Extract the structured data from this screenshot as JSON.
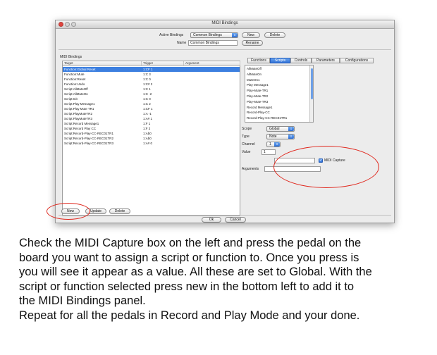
{
  "window": {
    "title": "MIDI Bindings"
  },
  "header": {
    "active_bindings_label": "Active Bindings",
    "active_bindings_value": "Common Bindings",
    "new_label": "New",
    "delete_label": "Delete",
    "name_label": "Name",
    "name_value": "Common Bindings",
    "rename_label": "Rename"
  },
  "bindings_panel": {
    "title": "MIDI Bindings",
    "columns": [
      "Target",
      "Trigger",
      "Argument"
    ],
    "rows": [
      {
        "target": "Function:Global Reset",
        "trigger": "1:CF 1",
        "argument": "",
        "selected": true
      },
      {
        "target": "Function:Mute",
        "trigger": "1:C 3",
        "argument": "",
        "selected": false
      },
      {
        "target": "Function:Reset",
        "trigger": "1:C 0",
        "argument": "",
        "selected": false
      },
      {
        "target": "Function:Undo",
        "trigger": "1:C# 2",
        "argument": "",
        "selected": false
      },
      {
        "target": "Script:AllMuteOff",
        "trigger": "1:C 1",
        "argument": "",
        "selected": false
      },
      {
        "target": "Script:AllMuteOn",
        "trigger": "1:C -2",
        "argument": "",
        "selected": false
      },
      {
        "target": "Script:Init",
        "trigger": "1:C 0",
        "argument": "",
        "selected": false
      },
      {
        "target": "Script:Play Message1",
        "trigger": "1:C 2",
        "argument": "",
        "selected": false
      },
      {
        "target": "Script:Play Mute TR1",
        "trigger": "1:CF 1",
        "argument": "",
        "selected": false
      },
      {
        "target": "Script:PlayMuteTR2",
        "trigger": "1:A -1",
        "argument": "",
        "selected": false
      },
      {
        "target": "Script:PlayMuteTR3",
        "trigger": "1:A# 1",
        "argument": "",
        "selected": false
      },
      {
        "target": "Script:Record Message1",
        "trigger": "1:F 1",
        "argument": "",
        "selected": false
      },
      {
        "target": "Script:Record Play CC",
        "trigger": "1:F 2",
        "argument": "",
        "selected": false
      },
      {
        "target": "Script:Record-Play-CC-REC01TR1",
        "trigger": "1:Ab0",
        "argument": "",
        "selected": false
      },
      {
        "target": "Script:Record-Play-CC-REC01TR2",
        "trigger": "1:Ab0",
        "argument": "",
        "selected": false
      },
      {
        "target": "Script:Record-Play-CC-REC01TR3",
        "trigger": "1:A# 0",
        "argument": "",
        "selected": false
      }
    ]
  },
  "target_tabs": [
    "Functions",
    "Scripts",
    "Controls",
    "Parameters",
    "Configurations"
  ],
  "active_tab": "Scripts",
  "scripts_list": [
    "AllMuteOff",
    "AllMuteOn",
    "MuteOn1",
    "Play Message1",
    "Play-Mute-TR1",
    "Play-Mute-TR2",
    "Play-Mute-TR3",
    "Record Message1",
    "Record-Play-CC",
    "Record-Play-CC-REC01TR1"
  ],
  "form": {
    "scope_label": "Scope",
    "scope_value": "Global",
    "type_label": "Type",
    "type_value": "Note",
    "channel_label": "Channel",
    "channel_value": "1",
    "value_label": "Value",
    "value_value": "1",
    "midi_capture_label": "MIDI Capture",
    "midi_capture_checked": true,
    "arguments_label": "Arguments"
  },
  "bottom_buttons": {
    "new": "New",
    "update": "Update",
    "delete": "Delete"
  },
  "dialog_buttons": {
    "ok": "Ok",
    "cancel": "Cancel"
  },
  "annotations": {
    "ring_color": "#e0281e"
  },
  "instructions": [
    "Check the MIDI Capture box on the left and press the pedal on the",
    "board you want to assign a script or function to.  Once you press is",
    "you will see it appear as a value.  All these are set to Global. With the",
    "script or function selected press new in the bottom left to add it to",
    "the MIDI Bindings panel.",
    "Repeat for all the pedals in Record and Play Mode and your done."
  ]
}
